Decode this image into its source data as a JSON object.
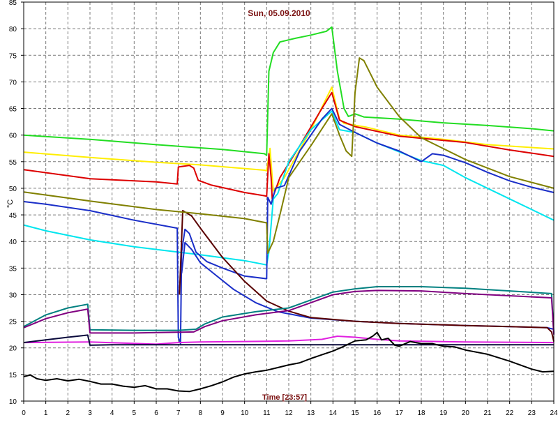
{
  "chart_data": {
    "type": "line",
    "title": "Sun, 05.09.2010",
    "xlabel": "Time [23:57]",
    "ylabel": "°C",
    "xlim": [
      0,
      24
    ],
    "ylim": [
      10,
      85
    ],
    "x_ticks": [
      0,
      1,
      2,
      3,
      4,
      5,
      6,
      7,
      8,
      9,
      10,
      11,
      12,
      13,
      14,
      15,
      16,
      17,
      18,
      19,
      20,
      21,
      22,
      23,
      24
    ],
    "y_ticks": [
      10,
      15,
      20,
      25,
      30,
      35,
      40,
      45,
      50,
      55,
      60,
      65,
      70,
      75,
      80,
      85
    ],
    "grid": true,
    "background": "#ffffff",
    "series": [
      {
        "color": "#22dd22",
        "points": [
          [
            0,
            60.0
          ],
          [
            3,
            59.2
          ],
          [
            6,
            58.2
          ],
          [
            9,
            57.3
          ],
          [
            10.9,
            56.5
          ],
          [
            11.0,
            56.2
          ],
          [
            11.1,
            72
          ],
          [
            11.3,
            75.5
          ],
          [
            11.6,
            77.5
          ],
          [
            12.3,
            78.2
          ],
          [
            13,
            78.8
          ],
          [
            13.7,
            79.5
          ],
          [
            13.95,
            80.3
          ],
          [
            14.2,
            72
          ],
          [
            14.5,
            65
          ],
          [
            14.7,
            63.5
          ],
          [
            15,
            64
          ],
          [
            15.4,
            63.4
          ],
          [
            17,
            63
          ],
          [
            19,
            62.3
          ],
          [
            21,
            61.8
          ],
          [
            23,
            61.2
          ],
          [
            24,
            60.8
          ]
        ]
      },
      {
        "color": "#ffee00",
        "points": [
          [
            0,
            56.8
          ],
          [
            3,
            55.8
          ],
          [
            6,
            54.9
          ],
          [
            8,
            54.4
          ],
          [
            10.9,
            53.4
          ],
          [
            11.0,
            53.3
          ],
          [
            11.15,
            57.5
          ],
          [
            11.3,
            49.5
          ],
          [
            11.8,
            52
          ],
          [
            13,
            61
          ],
          [
            13.95,
            69
          ],
          [
            14.3,
            63
          ],
          [
            14.5,
            62.2
          ],
          [
            15.5,
            61.5
          ],
          [
            17,
            60
          ],
          [
            19,
            59.2
          ],
          [
            21,
            58.2
          ],
          [
            24,
            57.4
          ]
        ]
      },
      {
        "color": "#dd0000",
        "points": [
          [
            0,
            53.5
          ],
          [
            3,
            51.8
          ],
          [
            6,
            51.2
          ],
          [
            6.95,
            50.8
          ],
          [
            7.0,
            54
          ],
          [
            7.5,
            54.3
          ],
          [
            7.7,
            53.8
          ],
          [
            7.9,
            51.5
          ],
          [
            8.5,
            50.6
          ],
          [
            10,
            49.2
          ],
          [
            10.9,
            48.6
          ],
          [
            11.0,
            48.5
          ],
          [
            11.1,
            56.5
          ],
          [
            11.2,
            52
          ],
          [
            11.25,
            48
          ],
          [
            11.6,
            52
          ],
          [
            12.5,
            58
          ],
          [
            13.5,
            65
          ],
          [
            13.95,
            68
          ],
          [
            14.3,
            62.8
          ],
          [
            15,
            61.6
          ],
          [
            17,
            59.8
          ],
          [
            19,
            59
          ],
          [
            20,
            58.6
          ],
          [
            22,
            57.2
          ],
          [
            24,
            56
          ]
        ]
      },
      {
        "color": "#00e5ee",
        "points": [
          [
            0,
            43.1
          ],
          [
            1,
            42
          ],
          [
            3,
            40.3
          ],
          [
            5,
            39
          ],
          [
            6,
            38.5
          ],
          [
            7,
            38
          ],
          [
            8,
            37.5
          ],
          [
            10,
            36.4
          ],
          [
            11.0,
            35.6
          ],
          [
            11.1,
            38
          ],
          [
            11.3,
            48
          ],
          [
            11.5,
            49
          ],
          [
            12,
            55
          ],
          [
            13,
            61
          ],
          [
            13.95,
            64.5
          ],
          [
            14.3,
            61
          ],
          [
            15,
            60.5
          ],
          [
            16,
            58.5
          ],
          [
            18,
            55.2
          ],
          [
            19,
            54.3
          ],
          [
            20,
            52
          ],
          [
            22,
            48
          ],
          [
            23,
            46
          ],
          [
            24,
            44
          ]
        ]
      },
      {
        "color": "#1a2ec8",
        "points": [
          [
            0,
            47.5
          ],
          [
            1,
            47
          ],
          [
            3,
            45.8
          ],
          [
            5,
            44
          ],
          [
            6.95,
            42.5
          ],
          [
            7.0,
            22
          ],
          [
            7.1,
            20.8
          ],
          [
            7.15,
            38
          ],
          [
            7.3,
            42.3
          ],
          [
            7.5,
            41.5
          ],
          [
            7.8,
            38
          ],
          [
            8.3,
            36.2
          ],
          [
            9,
            35
          ],
          [
            10,
            33.5
          ],
          [
            11.0,
            33
          ],
          [
            11.05,
            48.3
          ],
          [
            11.2,
            47
          ],
          [
            11.4,
            50
          ],
          [
            11.8,
            50.5
          ],
          [
            12.5,
            57
          ],
          [
            13.5,
            63
          ],
          [
            13.95,
            65
          ],
          [
            14.3,
            62
          ],
          [
            15,
            60.5
          ],
          [
            16,
            58.5
          ],
          [
            17,
            57
          ],
          [
            18,
            55
          ],
          [
            18.5,
            56.5
          ],
          [
            19,
            56.2
          ],
          [
            20,
            54.8
          ],
          [
            21,
            53
          ],
          [
            22,
            51.4
          ],
          [
            23,
            50.2
          ],
          [
            24,
            49.2
          ]
        ]
      },
      {
        "color": "#1a2ec8",
        "points": [
          [
            7.15,
            34
          ],
          [
            7.3,
            39.8
          ],
          [
            7.6,
            38.5
          ],
          [
            8,
            36
          ],
          [
            8.6,
            34
          ],
          [
            9.5,
            31
          ],
          [
            10.5,
            28.5
          ],
          [
            11.5,
            26.8
          ],
          [
            13,
            25.6
          ],
          [
            15,
            25
          ],
          [
            17,
            24.6
          ],
          [
            20,
            24.2
          ],
          [
            22,
            24
          ],
          [
            23.7,
            23.8
          ],
          [
            24,
            23.5
          ]
        ]
      },
      {
        "color": "#5a0000",
        "points": [
          [
            7.05,
            30
          ],
          [
            7.2,
            45.8
          ],
          [
            7.6,
            44.8
          ],
          [
            8,
            42.5
          ],
          [
            9,
            37
          ],
          [
            10,
            32.5
          ],
          [
            11,
            28.8
          ],
          [
            12,
            26.9
          ],
          [
            13,
            25.7
          ],
          [
            15,
            25
          ],
          [
            17,
            24.6
          ],
          [
            20,
            24.2
          ],
          [
            22,
            24
          ],
          [
            23.7,
            23.8
          ],
          [
            23.9,
            23
          ],
          [
            24,
            21.2
          ]
        ]
      },
      {
        "color": "#808000",
        "points": [
          [
            0,
            49.3
          ],
          [
            3,
            47.6
          ],
          [
            6,
            46
          ],
          [
            8,
            45.2
          ],
          [
            10,
            44.3
          ],
          [
            11.0,
            43.5
          ],
          [
            11.05,
            37.8
          ],
          [
            11.3,
            40
          ],
          [
            11.6,
            45
          ],
          [
            12,
            52
          ],
          [
            13,
            58
          ],
          [
            13.95,
            64
          ],
          [
            14.3,
            60
          ],
          [
            14.6,
            57
          ],
          [
            14.85,
            56
          ],
          [
            15.0,
            68
          ],
          [
            15.2,
            74.5
          ],
          [
            15.4,
            74
          ],
          [
            16,
            69
          ],
          [
            17,
            63.5
          ],
          [
            18,
            59.5
          ],
          [
            20,
            55.4
          ],
          [
            22,
            52.2
          ],
          [
            24,
            50
          ]
        ]
      },
      {
        "color": "#008080",
        "points": [
          [
            0,
            24
          ],
          [
            1,
            26.2
          ],
          [
            2,
            27.5
          ],
          [
            2.9,
            28.2
          ],
          [
            3.0,
            23.4
          ],
          [
            5,
            23.3
          ],
          [
            7,
            23.3
          ],
          [
            7.8,
            23.5
          ],
          [
            8.2,
            24.5
          ],
          [
            9,
            25.8
          ],
          [
            10.5,
            26.8
          ],
          [
            12,
            27.5
          ],
          [
            13,
            29
          ],
          [
            14,
            30.5
          ],
          [
            15,
            31.1
          ],
          [
            16,
            31.5
          ],
          [
            18,
            31.5
          ],
          [
            20,
            31.2
          ],
          [
            22,
            30.7
          ],
          [
            23.9,
            30.2
          ],
          [
            24,
            22.8
          ]
        ]
      },
      {
        "color": "#800080",
        "points": [
          [
            0,
            23.8
          ],
          [
            1,
            25.5
          ],
          [
            2,
            26.6
          ],
          [
            2.9,
            27.3
          ],
          [
            3.0,
            22.8
          ],
          [
            5,
            22.8
          ],
          [
            7.7,
            23
          ],
          [
            8.2,
            24
          ],
          [
            9,
            25.1
          ],
          [
            10.5,
            26.2
          ],
          [
            12,
            27
          ],
          [
            13,
            28.5
          ],
          [
            14,
            30
          ],
          [
            15,
            30.6
          ],
          [
            16,
            30.8
          ],
          [
            18,
            30.7
          ],
          [
            20,
            30.2
          ],
          [
            22,
            29.8
          ],
          [
            23.9,
            29.4
          ],
          [
            24,
            22.5
          ]
        ]
      },
      {
        "color": "#e020e0",
        "points": [
          [
            0,
            21
          ],
          [
            3,
            21.1
          ],
          [
            6,
            20.7
          ],
          [
            7,
            21
          ],
          [
            8,
            21.1
          ],
          [
            10,
            21.2
          ],
          [
            12,
            21.3
          ],
          [
            13.5,
            21.6
          ],
          [
            14.2,
            22.2
          ],
          [
            15,
            22
          ],
          [
            16,
            21.6
          ],
          [
            17,
            21.3
          ],
          [
            20,
            21.1
          ],
          [
            24,
            21
          ]
        ]
      },
      {
        "color": "#0a0a3c",
        "points": [
          [
            0,
            21
          ],
          [
            1,
            21.5
          ],
          [
            2,
            22
          ],
          [
            2.9,
            22.4
          ],
          [
            3.0,
            20.5
          ],
          [
            4,
            20.6
          ],
          [
            6,
            20.6
          ],
          [
            7,
            20.6
          ],
          [
            24,
            20.6
          ]
        ]
      },
      {
        "color": "#000000",
        "points": [
          [
            0,
            14.6
          ],
          [
            0.3,
            14.9
          ],
          [
            0.6,
            14.2
          ],
          [
            1,
            13.9
          ],
          [
            1.5,
            14.2
          ],
          [
            2,
            13.8
          ],
          [
            2.5,
            14.1
          ],
          [
            3,
            13.7
          ],
          [
            3.5,
            13.2
          ],
          [
            4,
            13.2
          ],
          [
            4.5,
            12.8
          ],
          [
            5,
            12.6
          ],
          [
            5.5,
            12.9
          ],
          [
            6,
            12.3
          ],
          [
            6.5,
            12.3
          ],
          [
            7,
            11.9
          ],
          [
            7.5,
            11.8
          ],
          [
            8,
            12.3
          ],
          [
            8.5,
            12.9
          ],
          [
            9,
            13.6
          ],
          [
            9.5,
            14.5
          ],
          [
            10,
            15.1
          ],
          [
            10.5,
            15.5
          ],
          [
            11,
            15.8
          ],
          [
            11.5,
            16.3
          ],
          [
            12,
            16.8
          ],
          [
            12.5,
            17.2
          ],
          [
            13,
            18
          ],
          [
            13.5,
            18.7
          ],
          [
            14,
            19.4
          ],
          [
            14.5,
            20.3
          ],
          [
            15,
            21.3
          ],
          [
            15.5,
            21.5
          ],
          [
            15.8,
            22.2
          ],
          [
            16.0,
            22.9
          ],
          [
            16.2,
            21.5
          ],
          [
            16.5,
            21.8
          ],
          [
            16.8,
            20.5
          ],
          [
            17,
            20.3
          ],
          [
            17.5,
            21.2
          ],
          [
            18,
            20.8
          ],
          [
            18.5,
            20.8
          ],
          [
            19,
            20.3
          ],
          [
            19.5,
            20.2
          ],
          [
            20,
            19.6
          ],
          [
            21,
            18.8
          ],
          [
            22,
            17.5
          ],
          [
            23,
            16
          ],
          [
            23.5,
            15.5
          ],
          [
            24,
            15.6
          ]
        ]
      }
    ]
  }
}
